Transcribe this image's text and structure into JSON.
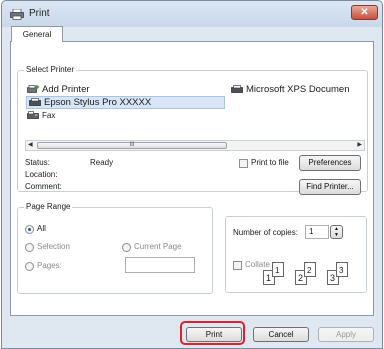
{
  "window": {
    "title": "Print",
    "close_glyph": "✕"
  },
  "tabs": [
    {
      "label": "General"
    }
  ],
  "select_printer": {
    "legend": "Select Printer",
    "printers": [
      {
        "label": "Add Printer",
        "icon": "add-printer-icon"
      },
      {
        "label": "Microsoft XPS Documen",
        "icon": "printer-icon"
      },
      {
        "label": "Epson Stylus Pro XXXXX",
        "icon": "printer-icon",
        "selected": true
      },
      {
        "label": "Fax",
        "icon": "fax-icon"
      }
    ],
    "scroll_grip": "III",
    "status_label": "Status:",
    "status_value": "Ready",
    "location_label": "Location:",
    "comment_label": "Comment:",
    "print_to_file_label": "Print to file",
    "preferences_label": "Preferences",
    "find_printer_label": "Find Printer..."
  },
  "page_range": {
    "legend": "Page Range",
    "all_label": "All",
    "selection_label": "Selection",
    "current_page_label": "Current Page",
    "pages_label": "Pages:",
    "pages_value": ""
  },
  "copies": {
    "number_label": "Number of copies:",
    "number_value": "1",
    "collate_label": "Collate",
    "collate_pages": [
      "1",
      "1",
      "2",
      "2",
      "3",
      "3"
    ]
  },
  "footer": {
    "print_label": "Print",
    "cancel_label": "Cancel",
    "apply_label": "Apply"
  },
  "colors": {
    "highlight": "#e0202a",
    "selection": "#d7e5f6"
  }
}
